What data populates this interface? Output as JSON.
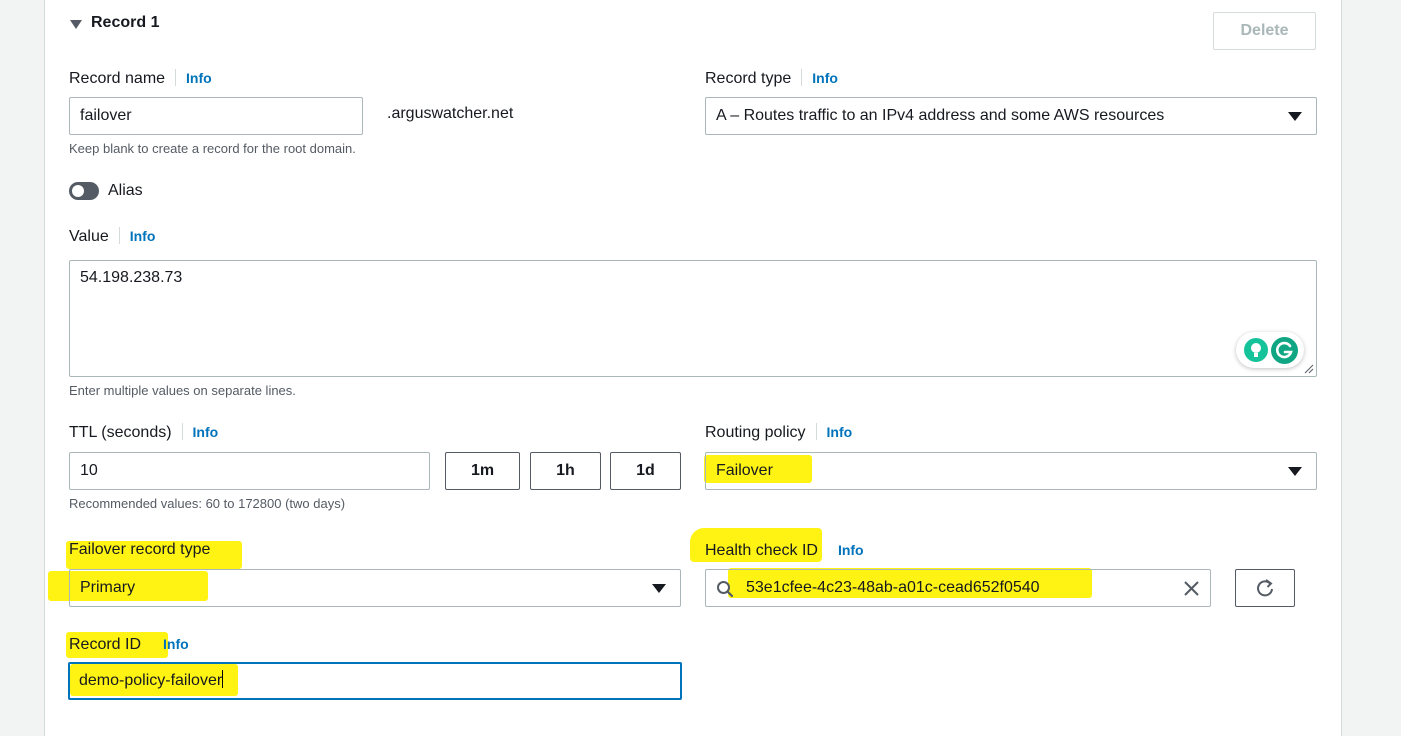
{
  "record": {
    "title": "Record 1",
    "delete_label": "Delete",
    "info_label": "Info",
    "record_name": {
      "label": "Record name",
      "value": "failover",
      "domain_suffix": ".arguswatcher.net",
      "hint": "Keep blank to create a record for the root domain."
    },
    "record_type": {
      "label": "Record type",
      "selected": "A – Routes traffic to an IPv4 address and some AWS resources"
    },
    "alias": {
      "label": "Alias",
      "enabled": false
    },
    "value": {
      "label": "Value",
      "text": "54.198.238.73",
      "hint": "Enter multiple values on separate lines."
    },
    "ttl": {
      "label": "TTL (seconds)",
      "value": "10",
      "presets": [
        "1m",
        "1h",
        "1d"
      ],
      "hint": "Recommended values: 60 to 172800 (two days)"
    },
    "routing_policy": {
      "label": "Routing policy",
      "selected": "Failover"
    },
    "failover_type": {
      "label": "Failover record type",
      "selected": "Primary"
    },
    "health_check": {
      "label": "Health check ID",
      "value": "53e1cfee-4c23-48ab-a01c-cead652f0540"
    },
    "record_id": {
      "label": "Record ID",
      "value": "demo-policy-failover"
    }
  },
  "colors": {
    "link": "#0073bb",
    "highlight": "#fff200",
    "border": "#aab7b8",
    "focus": "#0073bb"
  }
}
